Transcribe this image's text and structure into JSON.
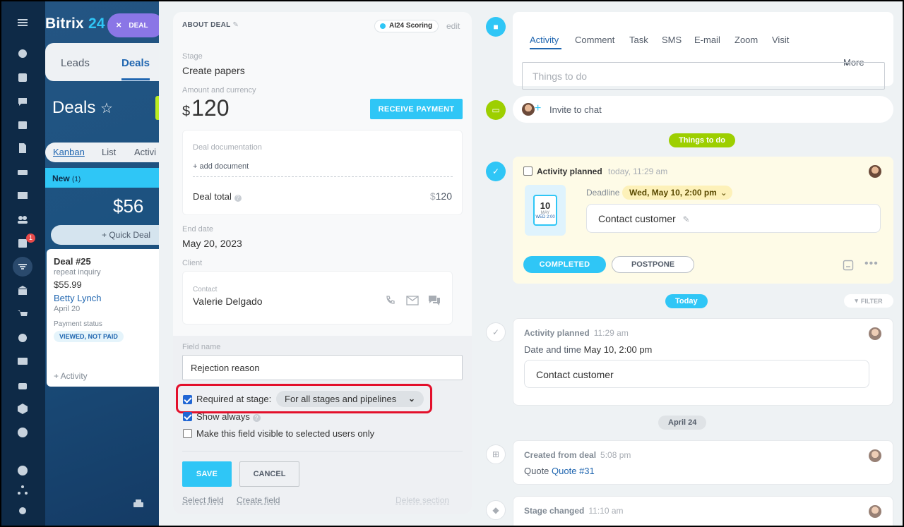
{
  "app": {
    "brand_a": "Bitrix",
    "brand_b": "24",
    "deal_pill": "DEAL",
    "notif_count": "1"
  },
  "crm_tabs": {
    "leads": "Leads",
    "deals": "Deals"
  },
  "deals_title": "Deals",
  "view_tabs": {
    "kanban": "Kanban",
    "list": "List",
    "activity": "Activi"
  },
  "kanban": {
    "column": "New",
    "column_count": "(1)",
    "sum": "$56",
    "quick_deal": "+ Quick Deal"
  },
  "deal_card": {
    "title": "Deal #25",
    "subtitle": "repeat inquiry",
    "amount": "$55.99",
    "contact": "Betty Lynch",
    "date": "April 20",
    "status_label": "Payment status",
    "status_badge": "VIEWED, NOT PAID",
    "add_activity": "+ Activity"
  },
  "about": {
    "header": "ABOUT DEAL",
    "ai_scoring": "AI24 Scoring",
    "edit": "edit",
    "stage_label": "Stage",
    "stage_value": "Create papers",
    "amount_label": "Amount and currency",
    "currency_symbol": "$",
    "amount_value": "120",
    "receive_payment": "RECEIVE PAYMENT",
    "doc_label": "Deal documentation",
    "add_document": "+ add document",
    "deal_total_label": "Deal total",
    "deal_total_currency": "$",
    "deal_total_value": "120",
    "end_date_label": "End date",
    "end_date_value": "May 20, 2023",
    "client_label": "Client",
    "contact_label": "Contact",
    "contact_name": "Valerie Delgado"
  },
  "field_editor": {
    "field_name_label": "Field name",
    "field_name_value": "Rejection reason",
    "required_label": "Required at stage:",
    "required_checked": true,
    "stage_select": "For all stages and pipelines",
    "show_always_label": "Show always",
    "show_always_checked": true,
    "visible_selected_label": "Make this field visible to selected users only",
    "visible_selected_checked": false,
    "save": "SAVE",
    "cancel": "CANCEL",
    "select_field": "Select field",
    "create_field": "Create field",
    "delete_section": "Delete section"
  },
  "timeline": {
    "tabs": [
      "Activity",
      "Comment",
      "Task",
      "SMS",
      "E-mail",
      "Zoom",
      "Visit"
    ],
    "more": "More",
    "todo_placeholder": "Things to do",
    "invite_chat": "Invite to chat",
    "things_to_do_pill": "Things to do",
    "planned": {
      "title": "Activity planned",
      "time": "today, 11:29 am",
      "deadline_label": "Deadline",
      "deadline_value": "Wed, May 10, 2:00 pm",
      "calendar_day": "10",
      "calendar_month": "MAY",
      "calendar_time": "WED 2:00",
      "text": "Contact customer",
      "completed": "COMPLETED",
      "postpone": "POSTPONE"
    },
    "today_pill": "Today",
    "filter": "FILTER",
    "history1": {
      "title": "Activity planned",
      "time": "11:29 am",
      "line_label": "Date and time",
      "line_value": "May 10, 2:00 pm",
      "text": "Contact customer"
    },
    "april_pill": "April 24",
    "history2": {
      "title": "Created from deal",
      "time": "5:08 pm",
      "quote_label": "Quote",
      "quote_link": "Quote #31"
    },
    "history3": {
      "title": "Stage changed",
      "time": "11:10 am"
    }
  },
  "colors": {
    "accent": "#2fc6f6",
    "link": "#2066b0",
    "green": "#9dcf00",
    "highlight": "#e3102b"
  }
}
